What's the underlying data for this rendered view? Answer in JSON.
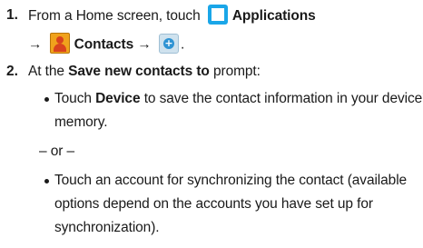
{
  "steps": [
    {
      "number": "1.",
      "prefix": "From a Home screen, touch",
      "apps_label": "Applications",
      "arrow1": "→",
      "contacts_label": "Contacts",
      "arrow2": "→",
      "end": "."
    },
    {
      "number": "2.",
      "prefix": "At the",
      "prompt_name": "Save new contacts to",
      "suffix": "prompt:"
    }
  ],
  "bullet1": {
    "before": "Touch",
    "bold": "Device",
    "after": "to save the contact information in your device's",
    "line2": "memory."
  },
  "or_text": "– or –",
  "bullet2": {
    "line1": "Touch an account for synchronizing the contact (available",
    "line2": "options depend on the accounts you have set up for",
    "line3": "synchronization)."
  },
  "icons": {
    "applications": "apps-grid-icon",
    "contacts": "contacts-icon",
    "add": "add-contact-icon"
  },
  "colors": {
    "apps_icon": "#1aa6e8",
    "contacts_icon": "#f0a21c",
    "add_icon": "#2e93d3"
  }
}
